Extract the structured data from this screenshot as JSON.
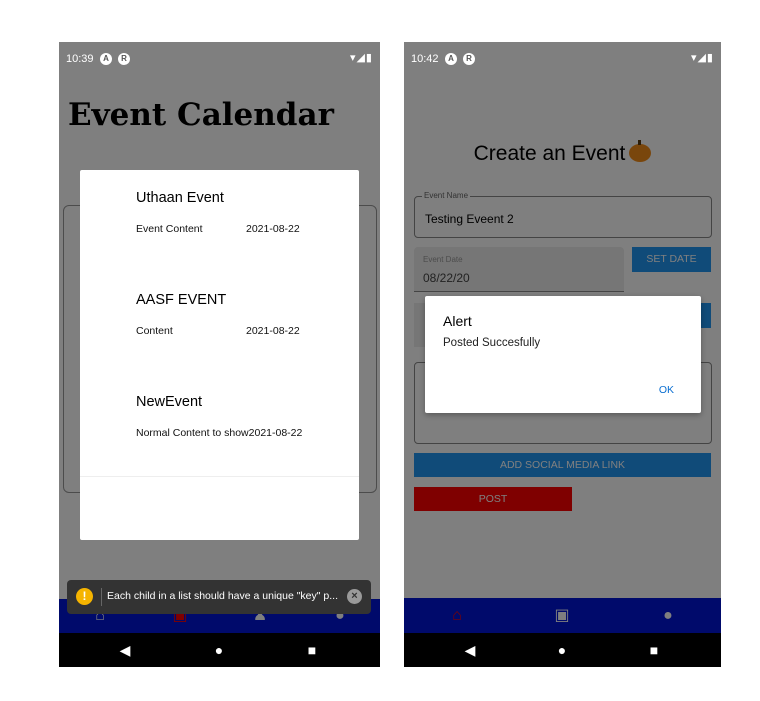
{
  "phone1": {
    "status": {
      "time": "10:39",
      "icons": [
        "a-icon",
        "r-icon"
      ],
      "right": "▾◢▮"
    },
    "title": "Event Calendar",
    "modal": {
      "events": [
        {
          "title": "Uthaan Event",
          "content": "Event Content",
          "date": "2021-08-22"
        },
        {
          "title": "AASF EVENT",
          "content": "Content",
          "date": "2021-08-22"
        },
        {
          "title": "NewEvent",
          "content": "Normal Content to show",
          "date": "2021-08-22"
        }
      ]
    },
    "toast": {
      "message": "Each child in a list should have a unique \"key\" p..."
    }
  },
  "phone2": {
    "status": {
      "time": "10:42",
      "icons": [
        "a-icon",
        "r-icon"
      ],
      "right": "▾◢▮"
    },
    "title": "Create an Event",
    "event_name": {
      "label": "Event Name",
      "value": "Testing Eveent 2"
    },
    "event_date": {
      "label": "Event Date",
      "value": "08/22/20"
    },
    "set_date_label": "SET DATE",
    "social_label": "ADD SOCIAL MEDIA LINK",
    "post_label": "POST",
    "alert": {
      "title": "Alert",
      "message": "Posted Succesfully",
      "ok": "OK"
    }
  },
  "colors": {
    "tabbar": "#0015d6",
    "primary": "#2196f3",
    "post": "#ff0000",
    "active_tab": "#ff0000"
  }
}
